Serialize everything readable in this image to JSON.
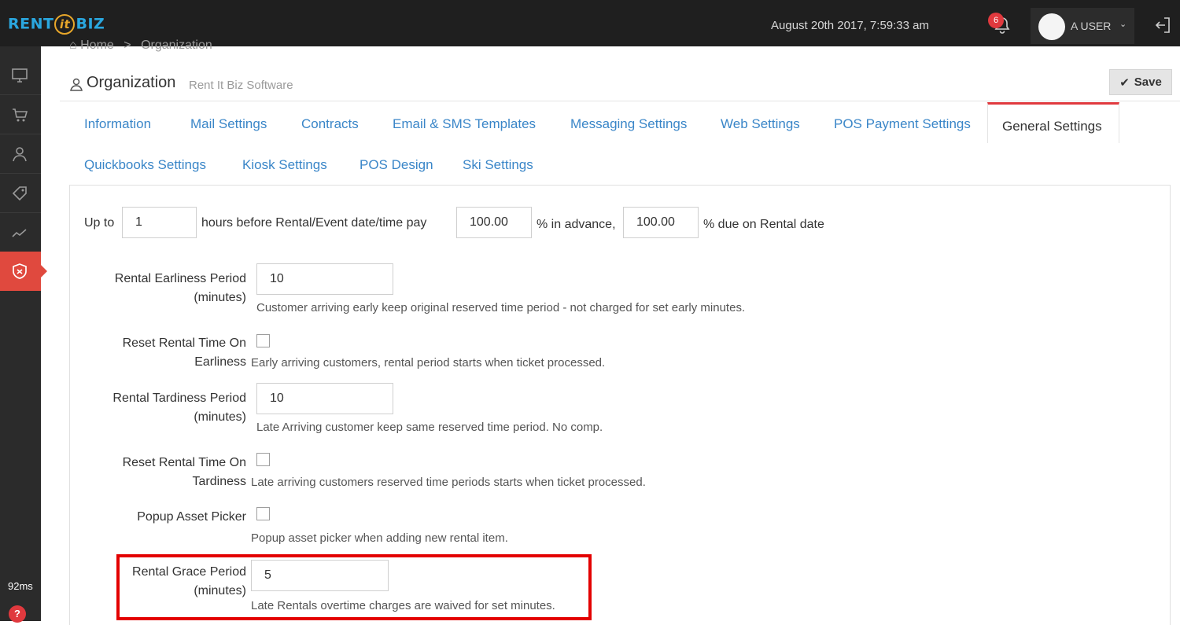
{
  "header": {
    "logo_rent": "RENT",
    "logo_it": "it",
    "logo_biz": "BIZ",
    "datetime": "August 20th 2017, 7:59:33 am",
    "notification_count": "6",
    "user_name": "A USER"
  },
  "sidebar": {
    "items": [
      "desktop-icon",
      "cart-icon",
      "users-icon",
      "tag-icon",
      "chart-icon",
      "shield-icon"
    ],
    "active_index": 5,
    "perf": "92ms",
    "help": "?"
  },
  "breadcrumb": {
    "home": "Home",
    "sep": ">",
    "current": "Organization"
  },
  "page": {
    "title": "Organization",
    "subtitle": "Rent It Biz Software",
    "save_label": "Save"
  },
  "tabs": {
    "row1": [
      "Information",
      "Mail Settings",
      "Contracts",
      "Email & SMS Templates",
      "Messaging Settings",
      "Web Settings",
      "POS Payment Settings",
      "General Settings"
    ],
    "row2": [
      "Quickbooks Settings",
      "Kiosk Settings",
      "POS Design",
      "Ski Settings"
    ],
    "active": "General Settings"
  },
  "form": {
    "pay_prefix": "Up to",
    "pay_hours": "1",
    "pay_mid": "hours before Rental/Event date/time pay",
    "pay_advance": "100.00",
    "pay_advance_suffix": "% in advance,",
    "pay_due": "100.00",
    "pay_due_suffix": "% due on Rental date",
    "earliness_label_1": "Rental Earliness Period",
    "earliness_label_2": "(minutes)",
    "earliness_value": "10",
    "earliness_hint": "Customer arriving early keep original reserved time period - not charged for set early minutes.",
    "reset_earliness_label_1": "Reset Rental Time On",
    "reset_earliness_label_2": "Earliness",
    "reset_earliness_hint": "Early arriving customers, rental period starts when ticket processed.",
    "tardiness_label_1": "Rental Tardiness Period",
    "tardiness_label_2": "(minutes)",
    "tardiness_value": "10",
    "tardiness_hint": "Late Arriving customer keep same reserved time period. No comp.",
    "reset_tardiness_label_1": "Reset Rental Time On",
    "reset_tardiness_label_2": "Tardiness",
    "reset_tardiness_hint": "Late arriving customers reserved time periods starts when ticket processed.",
    "popup_label": "Popup Asset Picker",
    "popup_hint": "Popup asset picker when adding new rental item.",
    "grace_label_1": "Rental Grace Period",
    "grace_label_2": "(minutes)",
    "grace_value": "5",
    "grace_hint": "Late Rentals overtime charges are waived for set minutes."
  },
  "colors": {
    "topbar": "#1f1f1f",
    "sidebar": "#2b2b2b",
    "accent": "#e0493e",
    "link": "#3a86c8",
    "highlight": "#e30000"
  }
}
